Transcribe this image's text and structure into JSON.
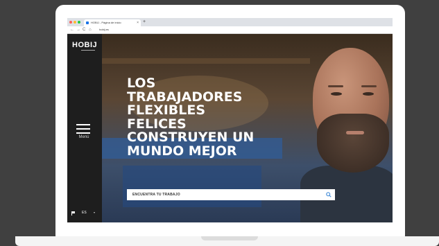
{
  "browser": {
    "tab_title": "HOBIJ - Página de inicio",
    "tab_close": "×",
    "new_tab": "+",
    "url": "hobij.es",
    "back": "←",
    "forward": "→",
    "reload": "C",
    "home": "⌂"
  },
  "sidebar": {
    "logo": "HOBIJ",
    "menu_label": "Menú",
    "language": "ES",
    "language_caret": "▾"
  },
  "hero": {
    "headline_lines": [
      "LOS",
      "TRABAJADORES",
      "FLEXIBLES",
      "FELICES",
      "CONSTRUYEN UN",
      "MUNDO MEJOR"
    ]
  },
  "search": {
    "placeholder": "ENCUENTRA TU TRABAJO"
  },
  "colors": {
    "sidebar_bg": "#1e1e1e",
    "search_icon": "#4a90d9",
    "desk_bg": "#404040"
  }
}
